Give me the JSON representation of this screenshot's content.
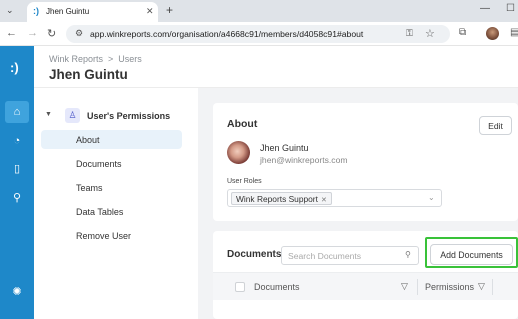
{
  "browser": {
    "tab_title": "Jhen Guintu",
    "url": "app.winkreports.com/organisation/a4668c91/members/d4058c91#about"
  },
  "breadcrumb": {
    "root": "Wink Reports",
    "separator": ">",
    "current": "Users"
  },
  "page_title": "Jhen Guintu",
  "permissions_nav": {
    "heading": "User's Permissions",
    "items": [
      {
        "label": "About",
        "active": true
      },
      {
        "label": "Documents",
        "active": false
      },
      {
        "label": "Teams",
        "active": false
      },
      {
        "label": "Data Tables",
        "active": false
      },
      {
        "label": "Remove User",
        "active": false
      }
    ]
  },
  "about": {
    "title": "About",
    "edit_label": "Edit",
    "user_name": "Jhen Guintu",
    "user_email": "jhen@winkreports.com",
    "roles_label": "User Roles",
    "roles": [
      "Wink Reports Support"
    ]
  },
  "documents": {
    "title": "Documents",
    "search_placeholder": "Search Documents",
    "add_label": "Add Documents",
    "columns": [
      "Documents",
      "Permissions"
    ]
  },
  "colors": {
    "brand": "#1e88c9",
    "highlight": "#39c239",
    "active_item_bg": "#e8f2fa"
  }
}
